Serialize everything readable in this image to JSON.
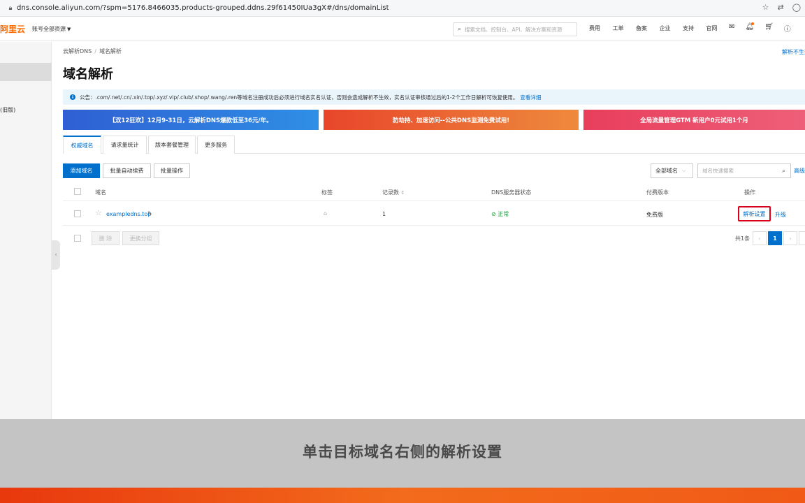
{
  "browser": {
    "url": "dns.console.aliyun.com/?spm=5176.8466035.products-grouped.ddns.29f61450IUa3gX#/dns/domainList"
  },
  "topbar": {
    "logo": "阿里云",
    "resource_selector": "账号全部资源",
    "search_placeholder": "搜索文档、控制台、API、解决方案和资源",
    "nav": [
      "费用",
      "工单",
      "备案",
      "企业",
      "支持",
      "官网"
    ]
  },
  "sidebar": {
    "old_version_label": "(旧版)"
  },
  "breadcrumb": [
    "云解析DNS",
    "域名解析"
  ],
  "help_link": "解析不生效",
  "page_title": "域名解析",
  "notice": {
    "text": "公告：.com/.net/.cn/.xin/.top/.xyz/.vip/.club/.shop/.wang/.ren等域名注册成功后必须进行域名实名认证，否则会造成解析不生效，实名认证审核通过后的1-2个工作日解析可恢复使用。",
    "link": "查看详细"
  },
  "banners": [
    "【双12狂欢】12月9-31日，云解析DNS爆款低至36元/年。",
    "防劫持、加速访问--公共DNS监测免费试用!",
    "全局流量管理GTM 新用户0元试用1个月"
  ],
  "tabs": [
    "权威域名",
    "请求量统计",
    "版本套餐管理",
    "更多服务"
  ],
  "toolbar": {
    "add_domain": "添加域名",
    "batch_renew": "批量自动续费",
    "batch_ops": "批量操作",
    "domain_filter": "全部域名",
    "quick_search_placeholder": "域名快速搜索",
    "advanced": "高级"
  },
  "table": {
    "headers": [
      "域名",
      "标签",
      "记录数",
      "DNS服务器状态",
      "付费版本",
      "操作"
    ],
    "rows": [
      {
        "domain": "exampledns.top",
        "records": "1",
        "dns_status": "正常",
        "edition": "免费版",
        "action_primary": "解析设置",
        "action_secondary": "升级"
      }
    ]
  },
  "footer": {
    "delete": "删 除",
    "change_group": "更换分组",
    "total": "共1条",
    "current_page": "1"
  },
  "caption": "单击目标域名右侧的解析设置"
}
